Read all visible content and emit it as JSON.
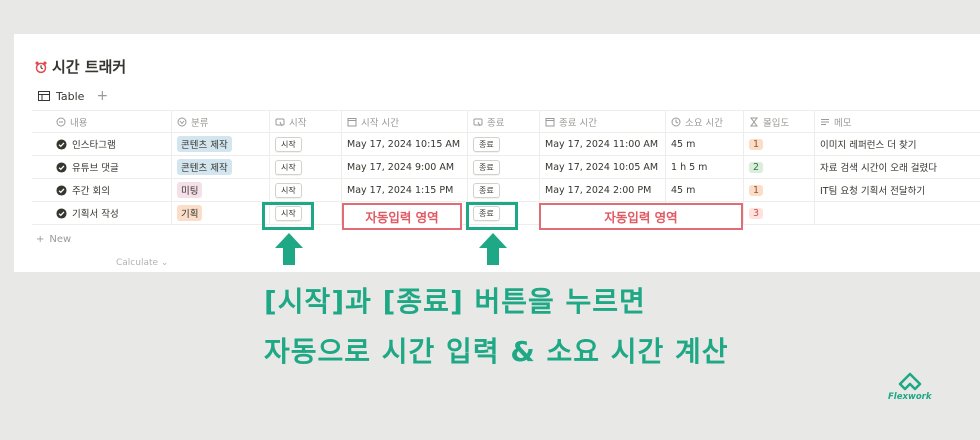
{
  "page": {
    "title": "시간 트래커",
    "view_label": "Table",
    "add_view": "+",
    "new_row": "New",
    "calculate": "Calculate ⌄"
  },
  "columns": [
    {
      "label": "내용",
      "icon": "title-icon"
    },
    {
      "label": "분류",
      "icon": "select-icon"
    },
    {
      "label": "시작",
      "icon": "button-icon"
    },
    {
      "label": "시작 시간",
      "icon": "calendar-icon"
    },
    {
      "label": "종료",
      "icon": "button-icon"
    },
    {
      "label": "종료 시간",
      "icon": "calendar-icon"
    },
    {
      "label": "소요 시간",
      "icon": "clock-icon"
    },
    {
      "label": "몰입도",
      "icon": "hourglass-icon"
    },
    {
      "label": "메모",
      "icon": "text-icon"
    }
  ],
  "rows": [
    {
      "name": "인스타그램",
      "category": "콘텐츠 제작",
      "cat_color": "#d3e5ef",
      "start_btn": "시작",
      "start_time": "May 17, 2024 10:15 AM",
      "end_btn": "종료",
      "end_time": "May 17, 2024 11:00 AM",
      "duration": "45 m",
      "focus": "1",
      "focus_color": "#fadec9",
      "memo": "이미지 레퍼런스 더 찾기"
    },
    {
      "name": "유튜브 댓글",
      "category": "콘텐츠 제작",
      "cat_color": "#d3e5ef",
      "start_btn": "시작",
      "start_time": "May 17, 2024 9:00 AM",
      "end_btn": "종료",
      "end_time": "May 17, 2024 10:05 AM",
      "duration": "1 h 5 m",
      "focus": "2",
      "focus_color": "#dbeddb",
      "memo": "자료 검색 시간이 오래 걸렸다"
    },
    {
      "name": "주간 회의",
      "category": "미팅",
      "cat_color": "#f5e0e9",
      "start_btn": "시작",
      "start_time": "May 17, 2024 1:15 PM",
      "end_btn": "종료",
      "end_time": "May 17, 2024 2:00 PM",
      "duration": "45 m",
      "focus": "1",
      "focus_color": "#fadec9",
      "memo": "IT팀 요청 기획서 전달하기"
    },
    {
      "name": "기획서 작성",
      "category": "기획",
      "cat_color": "#fadec9",
      "start_btn": "시작",
      "start_time": "",
      "end_btn": "종료",
      "end_time": "",
      "duration": "",
      "focus": "3",
      "focus_color": "#ffe2dd",
      "memo": ""
    }
  ],
  "annotations": {
    "auto_start": "자동입력 영역",
    "auto_end": "자동입력 영역",
    "caption_line1": "[시작]과 [종료] 버튼을 누르면",
    "caption_line2": "자동으로 시간 입력 & 소요 시간 계산",
    "logo_text": "Flexwork"
  },
  "colors": {
    "accent_green": "#1ea885",
    "auto_red": "#e05a63"
  }
}
